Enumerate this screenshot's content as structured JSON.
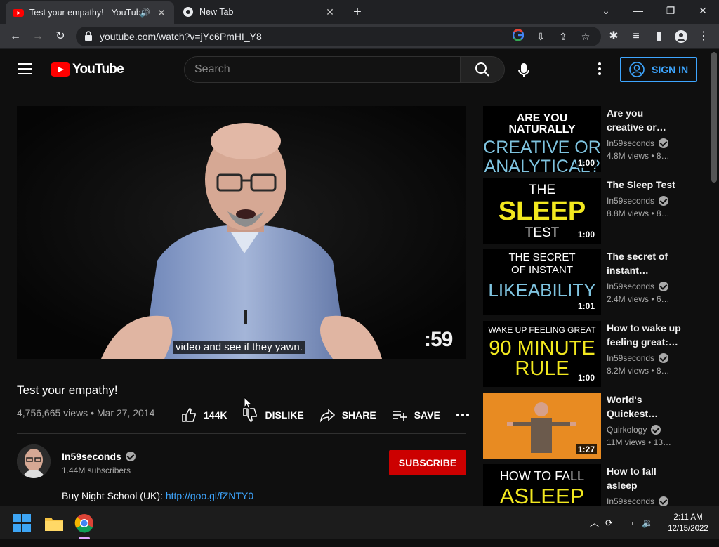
{
  "browser": {
    "tabs": [
      {
        "title": "Test your empathy! - YouTube",
        "active": true
      },
      {
        "title": "New Tab",
        "active": false
      }
    ],
    "url": "youtube.com/watch?v=jYc6PmHI_Y8"
  },
  "header": {
    "logo_text": "YouTube",
    "search_placeholder": "Search",
    "signin_label": "SIGN IN"
  },
  "video": {
    "caption": "video and see if they yawn.",
    "watermark": ":59",
    "title": "Test your empathy!",
    "views": "4,756,665 views",
    "date": "Mar 27, 2014",
    "likes": "144K",
    "dislike_label": "DISLIKE",
    "share_label": "SHARE",
    "save_label": "SAVE"
  },
  "channel": {
    "name": "In59seconds",
    "subscribers": "1.44M subscribers",
    "subscribe_label": "SUBSCRIBE",
    "description_prefix": "Buy Night School (UK): ",
    "description_link": "http://goo.gl/fZNTY0"
  },
  "sidebar": [
    {
      "thumb_lines": [
        "ARE YOU NATURALLY",
        "CREATIVE OR",
        "ANALYTICAL?"
      ],
      "duration": "1:00",
      "title_lines": [
        "Are you",
        "creative or…"
      ],
      "channel": "In59seconds",
      "meta": "4.8M views • 8…"
    },
    {
      "thumb_lines": [
        "THE",
        "SLEEP",
        "TEST"
      ],
      "duration": "1:00",
      "title_lines": [
        "The Sleep Test"
      ],
      "channel": "In59seconds",
      "meta": "8.8M views • 8…"
    },
    {
      "thumb_lines": [
        "THE SECRET",
        "OF INSTANT",
        "LIKEABILITY"
      ],
      "duration": "1:01",
      "title_lines": [
        "The secret of",
        "instant…"
      ],
      "channel": "In59seconds",
      "meta": "2.4M views • 6…"
    },
    {
      "thumb_lines": [
        "WAKE UP FEELING GREAT",
        "90 MINUTE",
        "RULE"
      ],
      "duration": "1:00",
      "title_lines": [
        "How to wake up",
        "feeling great:…"
      ],
      "channel": "In59seconds",
      "meta": "8.2M views • 8…"
    },
    {
      "thumb_lines": [],
      "duration": "1:27",
      "title_lines": [
        "World's",
        "Quickest…"
      ],
      "channel": "Quirkology",
      "meta": "11M views • 13…"
    },
    {
      "thumb_lines": [
        "HOW TO FALL",
        "ASLEEP"
      ],
      "duration": "",
      "title_lines": [
        "How to fall",
        "asleep"
      ],
      "channel": "In59seconds",
      "meta": ""
    }
  ],
  "taskbar": {
    "time": "2:11 AM",
    "date": "12/15/2022"
  },
  "colors": {
    "accent_blue": "#3ea6ff",
    "subscribe_red": "#cc0000",
    "thumb_blue": "#7fc4e0",
    "thumb_yellow": "#f2e81f"
  }
}
